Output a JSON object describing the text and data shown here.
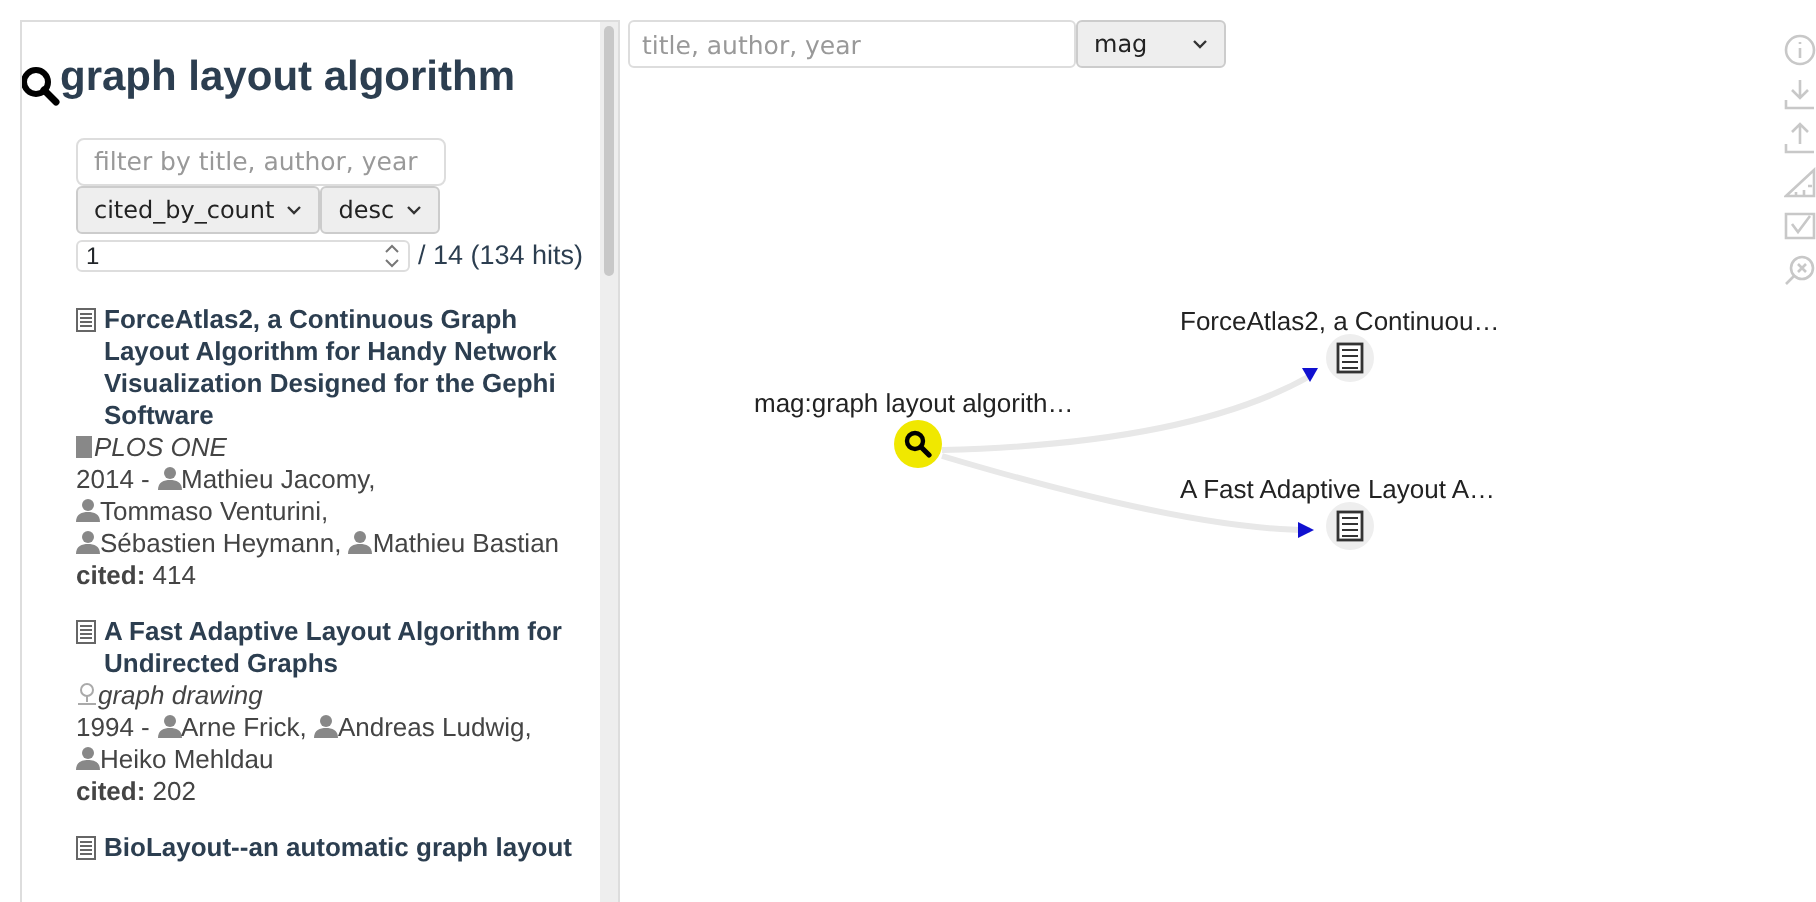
{
  "sidebar": {
    "query": "graph layout algorithm",
    "filter": {
      "placeholder": "filter by title, author, year"
    },
    "sort_field": "cited_by_count",
    "sort_order": "desc",
    "page": "1",
    "page_info": "/ 14 (134 hits)",
    "results": [
      {
        "title": "ForceAtlas2, a Continuous Graph Layout Algorithm for Handy Network Visualization Designed for the Gephi Software",
        "venue": {
          "kind": "journal",
          "text": "PLOS ONE"
        },
        "year": "2014 -",
        "authors": [
          "Mathieu Jacomy,",
          "Tommaso Venturini,",
          "Sébastien Heymann,",
          "Mathieu Bastian"
        ],
        "cited_label": "cited:",
        "cited": "414"
      },
      {
        "title": "A Fast Adaptive Layout Algorithm for Undirected Graphs",
        "venue": {
          "kind": "topic",
          "text": "graph drawing"
        },
        "year": "1994 -",
        "authors": [
          "Arne Frick,",
          "Andreas Ludwig,",
          "Heiko Mehldau"
        ],
        "cited_label": "cited:",
        "cited": "202"
      },
      {
        "title": "BioLayout--an automatic graph layout"
      }
    ]
  },
  "graph_toolbar": {
    "search": {
      "placeholder": "title, author, year"
    },
    "source": "mag"
  },
  "graph": {
    "nodes": [
      {
        "kind": "query",
        "label": "mag:graph layout algorith…"
      },
      {
        "kind": "paper",
        "label": "ForceAtlas2, a Continuou…"
      },
      {
        "kind": "paper",
        "label": "A Fast Adaptive Layout A…"
      }
    ]
  }
}
